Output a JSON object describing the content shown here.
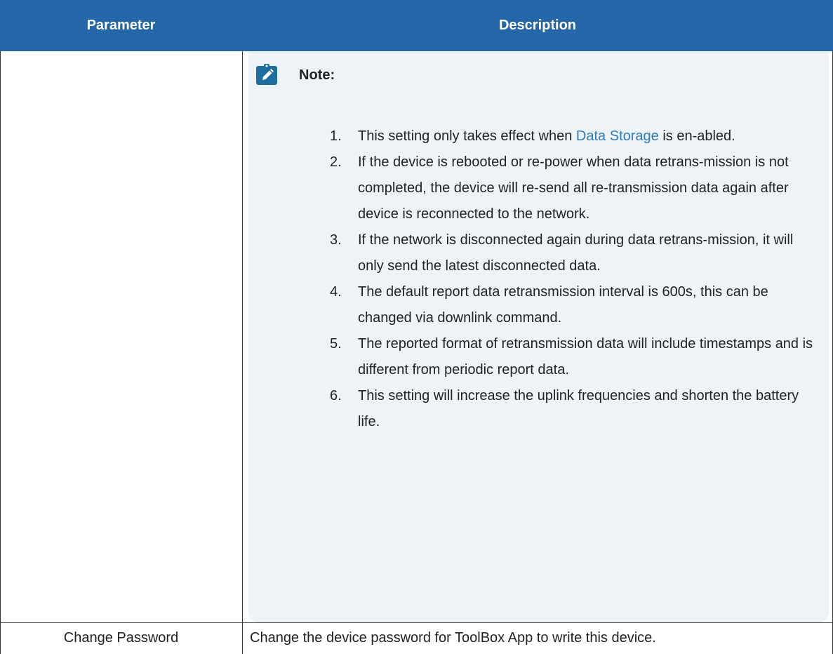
{
  "table": {
    "header": {
      "parameter": "Parameter",
      "description": "Description"
    },
    "note": {
      "icon": "pencil-note-icon",
      "title": "Note:",
      "items": [
        {
          "number": "1.",
          "text_before_link": "This setting only takes effect when ",
          "link_text": "Data Storage",
          "text_after_link": " is en-abled."
        },
        {
          "number": "2.",
          "text": "If the device is rebooted or re-power when data retrans-mission is not completed, the device will re-send all re-transmission data again after device is reconnected to the network."
        },
        {
          "number": "3.",
          "text": "If the network is disconnected again during data retrans-mission, it will only send the latest disconnected data."
        },
        {
          "number": "4.",
          "text": "The default report data retransmission interval is 600s, this can be changed via downlink command."
        },
        {
          "number": "5.",
          "text": "The reported format of retransmission data will include timestamps and is different from periodic report data."
        },
        {
          "number": "6.",
          "text": "This setting will increase the uplink frequencies and shorten the battery life."
        }
      ]
    },
    "rows": [
      {
        "parameter": "Change Password",
        "description": "Change the device password for ToolBox App to write this device."
      }
    ]
  },
  "colors": {
    "header_bg": "#2466a8",
    "note_bg": "#eef3f8",
    "link": "#2f7ab8",
    "icon_bg": "#1f6f9e"
  }
}
